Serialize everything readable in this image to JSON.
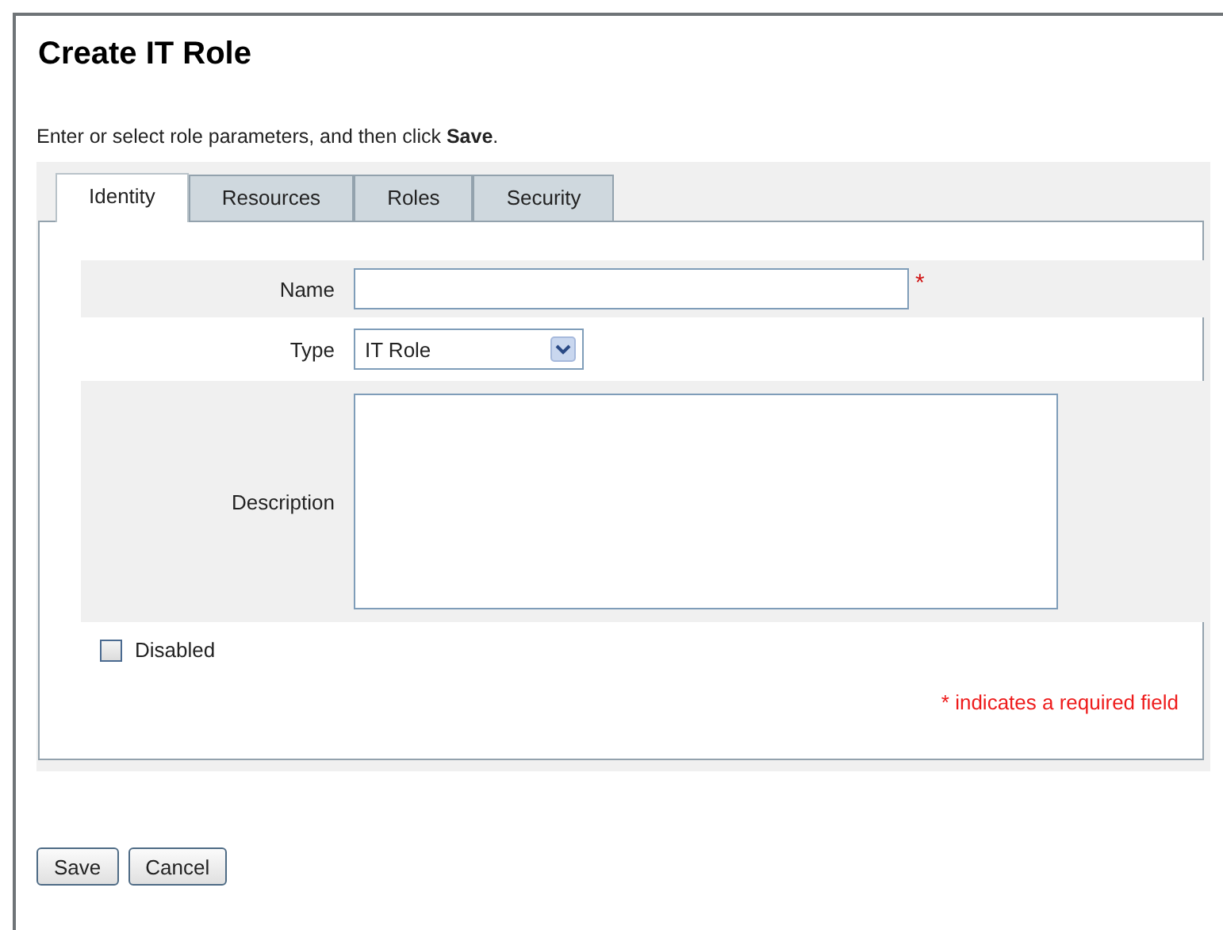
{
  "title": "Create IT Role",
  "instructions": "Enter or select role parameters, and then click **Save**.",
  "tabs": [
    {
      "label": "Identity",
      "selected": true
    },
    {
      "label": "Resources",
      "selected": false
    },
    {
      "label": "Roles",
      "selected": false
    },
    {
      "label": "Security",
      "selected": false
    }
  ],
  "form": {
    "name": {
      "label": "Name",
      "required_mark": "*"
    },
    "type": {
      "label": "Type",
      "value": "IT Role"
    },
    "description": {
      "label": "Description"
    },
    "disabled": {
      "label": "Disabled",
      "checked": false
    },
    "required_note": "* indicates a required field"
  },
  "buttons": [
    "Save",
    "Cancel"
  ]
}
